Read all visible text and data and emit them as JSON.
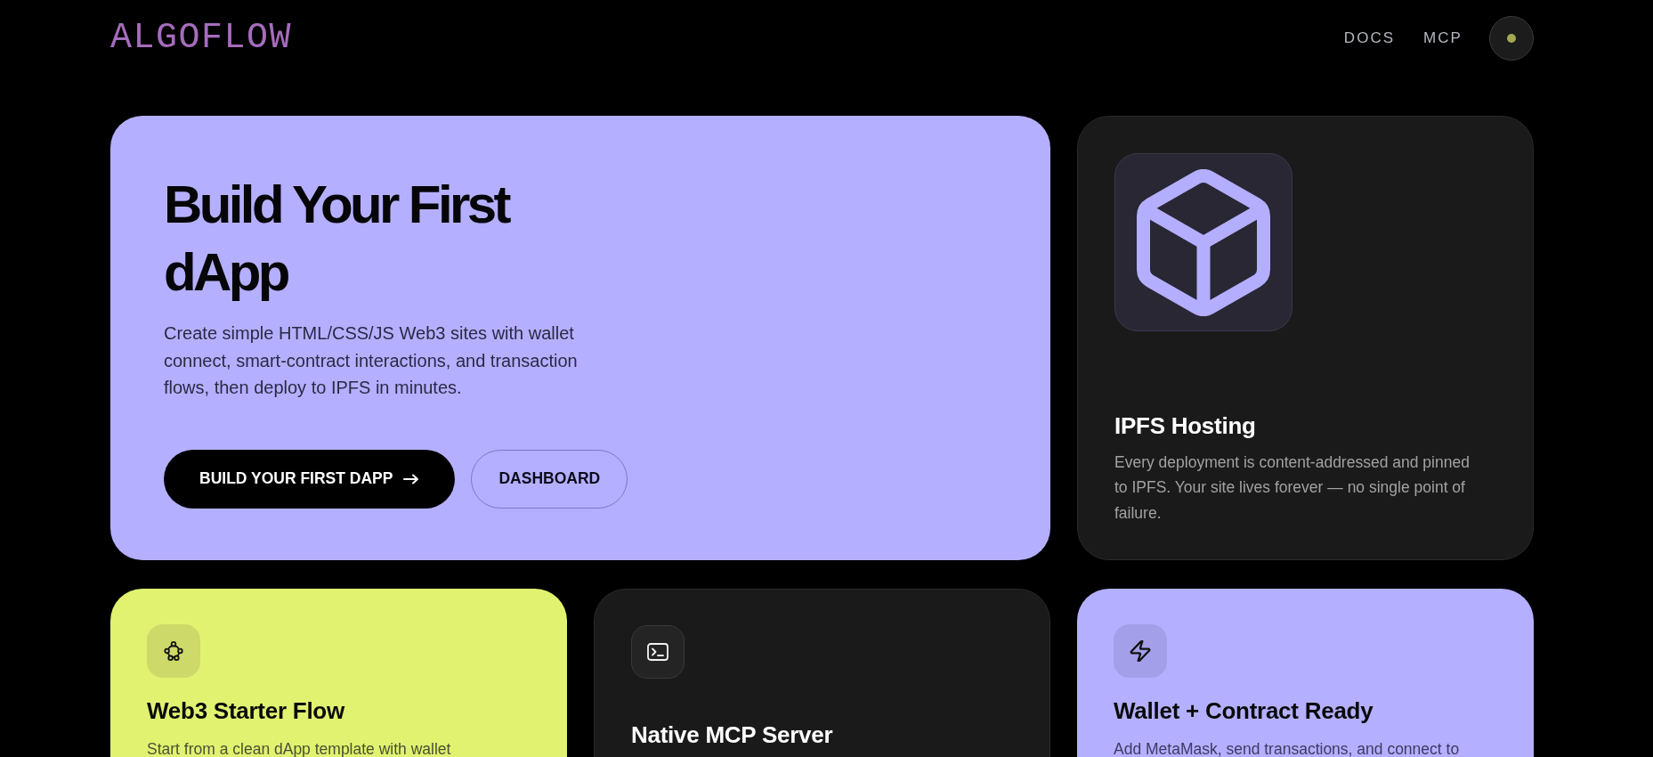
{
  "header": {
    "logo": "ALGOFLOW",
    "nav": [
      {
        "label": "DOCS"
      },
      {
        "label": "MCP"
      }
    ]
  },
  "hero": {
    "title": "Build Your First dApp",
    "description": "Create simple HTML/CSS/JS Web3 sites with wallet connect, smart-contract interactions, and transaction flows, then deploy to IPFS in minutes.",
    "buttons": [
      {
        "label": "BUILD YOUR FIRST DAPP",
        "kind": "primary"
      },
      {
        "label": "DASHBOARD",
        "kind": "secondary"
      }
    ]
  },
  "ipfs_card": {
    "title": "IPFS Hosting",
    "description": "Every deployment is content-addressed and pinned to IPFS. Your site lives forever — no single point of failure."
  },
  "features": [
    {
      "kind": "lime",
      "title": "Web3 Starter Flow",
      "description": "Start from a clean dApp template with wallet"
    },
    {
      "kind": "dark",
      "title": "Native MCP Server"
    },
    {
      "kind": "lavender",
      "title": "Wallet + Contract Ready",
      "description": "Add MetaMask, send transactions, and connect to"
    }
  ]
}
